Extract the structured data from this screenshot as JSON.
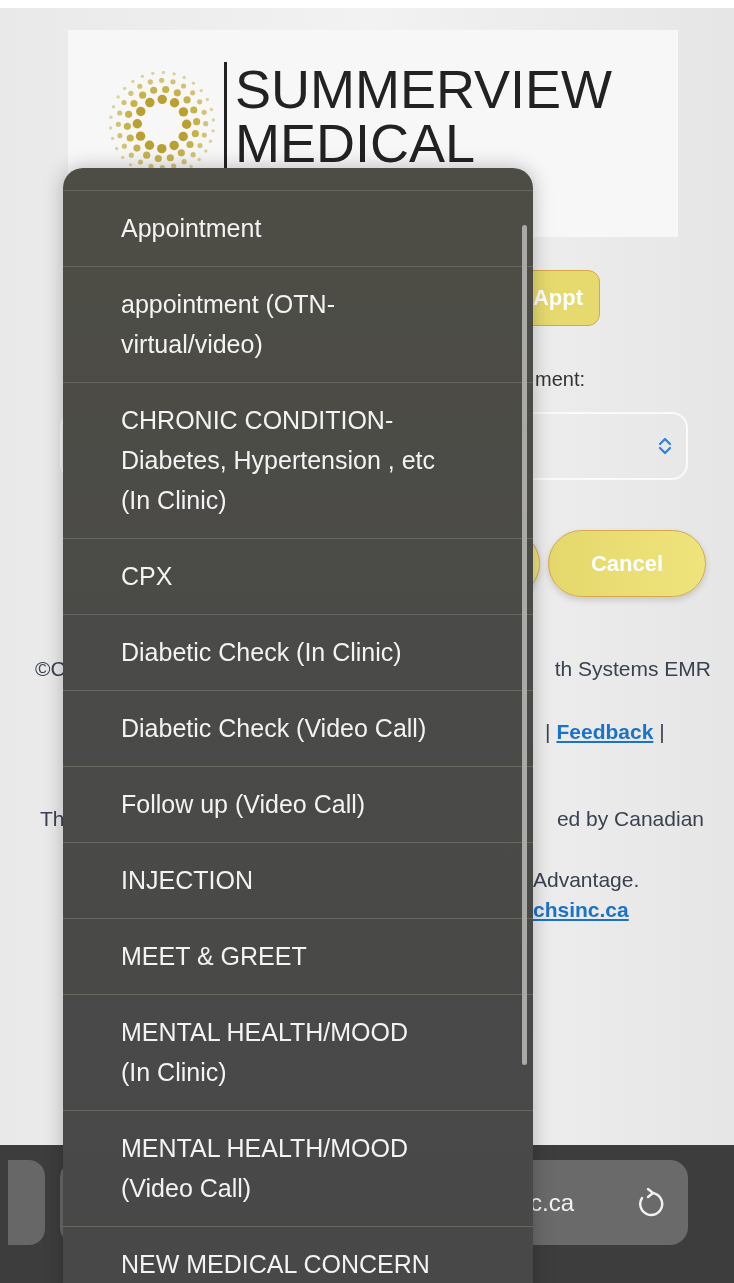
{
  "logo": {
    "lines": [
      "SUMMERVIEW",
      "MEDICAL"
    ]
  },
  "page": {
    "book_button": "Appt",
    "field_label": "ment:",
    "cancel_button": "Cancel",
    "footer": [
      {
        "kind": "split",
        "left": "©C",
        "right": "th Systems EMR"
      },
      {
        "kind": "links",
        "parts": [
          {
            "text": "|",
            "link": false
          },
          {
            "text": "Feedback",
            "link": true
          },
          {
            "text": "|",
            "link": false
          }
        ]
      },
      {
        "kind": "split",
        "left": "Th",
        "right": "ed by Canadian"
      },
      {
        "kind": "tail",
        "text": "Advantage."
      },
      {
        "kind": "tail-link",
        "text": "chsinc.ca"
      }
    ]
  },
  "browser_bar": {
    "address": "c.ca"
  },
  "dropdown": {
    "options": [
      {
        "lines": [
          "Appointment"
        ]
      },
      {
        "lines": [
          "appointment (OTN-",
          "virtual/video)"
        ]
      },
      {
        "lines": [
          "CHRONIC CONDITION-",
          "Diabetes, Hypertension , etc",
          "(In Clinic)"
        ]
      },
      {
        "lines": [
          "CPX"
        ]
      },
      {
        "lines": [
          "Diabetic Check (In Clinic)"
        ]
      },
      {
        "lines": [
          "Diabetic Check (Video Call)"
        ]
      },
      {
        "lines": [
          "Follow up (Video Call)"
        ]
      },
      {
        "lines": [
          "INJECTION"
        ]
      },
      {
        "lines": [
          "MEET & GREET"
        ]
      },
      {
        "lines": [
          "MENTAL HEALTH/MOOD",
          "(In Clinic)"
        ]
      },
      {
        "lines": [
          "MENTAL HEALTH/MOOD",
          "(Video Call)"
        ]
      },
      {
        "lines": [
          "NEW MEDICAL CONCERN"
        ]
      }
    ]
  }
}
